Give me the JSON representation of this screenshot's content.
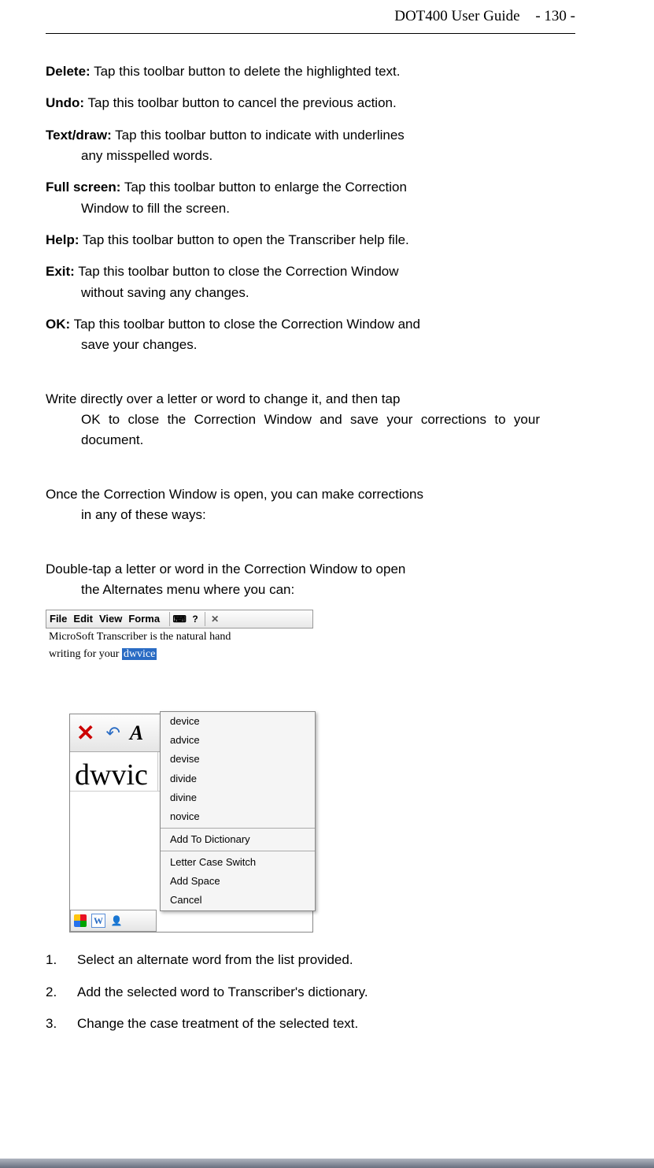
{
  "header": {
    "title": "DOT400 User Guide",
    "page": "- 130 -"
  },
  "definitions": [
    {
      "label": "Delete:",
      "text1": " Tap this toolbar button to delete the highlighted text.",
      "text2": ""
    },
    {
      "label": "Undo:",
      "text1": " Tap this toolbar button to cancel the previous action.",
      "text2": ""
    },
    {
      "label": "Text/draw:",
      "text1": " Tap this toolbar button to indicate with underlines",
      "text2": "any misspelled words."
    },
    {
      "label": "Full screen:",
      "text1": " Tap this toolbar button to enlarge the Correction",
      "text2": "Window to fill the screen."
    },
    {
      "label": "Help:",
      "text1": " Tap this toolbar button to open the Transcriber help file.",
      "text2": ""
    },
    {
      "label": "Exit:",
      "text1": " Tap this toolbar button to close the Correction Window",
      "text2": "without saving any changes."
    },
    {
      "label": "OK:",
      "text1": " Tap this toolbar button to close the Correction Window and",
      "text2": "save your changes."
    }
  ],
  "paragraphs": {
    "p1_line1": "Write directly over a letter or word to change it, and then tap",
    "p1_rest": "OK to close the Correction Window and save your corrections to your document.",
    "p2_line1": "Once the Correction Window is open, you can make corrections",
    "p2_rest": "in any of these ways:",
    "p3_line1": "Double-tap a letter or word in the Correction Window to open",
    "p3_rest": "the Alternates menu where you can:"
  },
  "screenshot": {
    "menubar": [
      "File",
      "Edit",
      "View",
      "Forma"
    ],
    "text_line1": "MicroSoft Transcriber is the natural hand",
    "text_line2_prefix": "writing for your ",
    "highlighted": "dwvice",
    "bigword": "dwvic",
    "alternates": [
      "device",
      "advice",
      "devise",
      "divide",
      "divine",
      "novice"
    ],
    "actions": [
      "Add To Dictionary",
      "Letter Case Switch",
      "Add Space",
      "Cancel"
    ],
    "w_letter": "W"
  },
  "numbered": [
    {
      "n": "1.",
      "text": "Select an alternate word from the list provided."
    },
    {
      "n": "2.",
      "text": "Add the selected word to Transcriber's dictionary."
    },
    {
      "n": "3.",
      "text": "Change the case treatment of the selected text."
    }
  ]
}
